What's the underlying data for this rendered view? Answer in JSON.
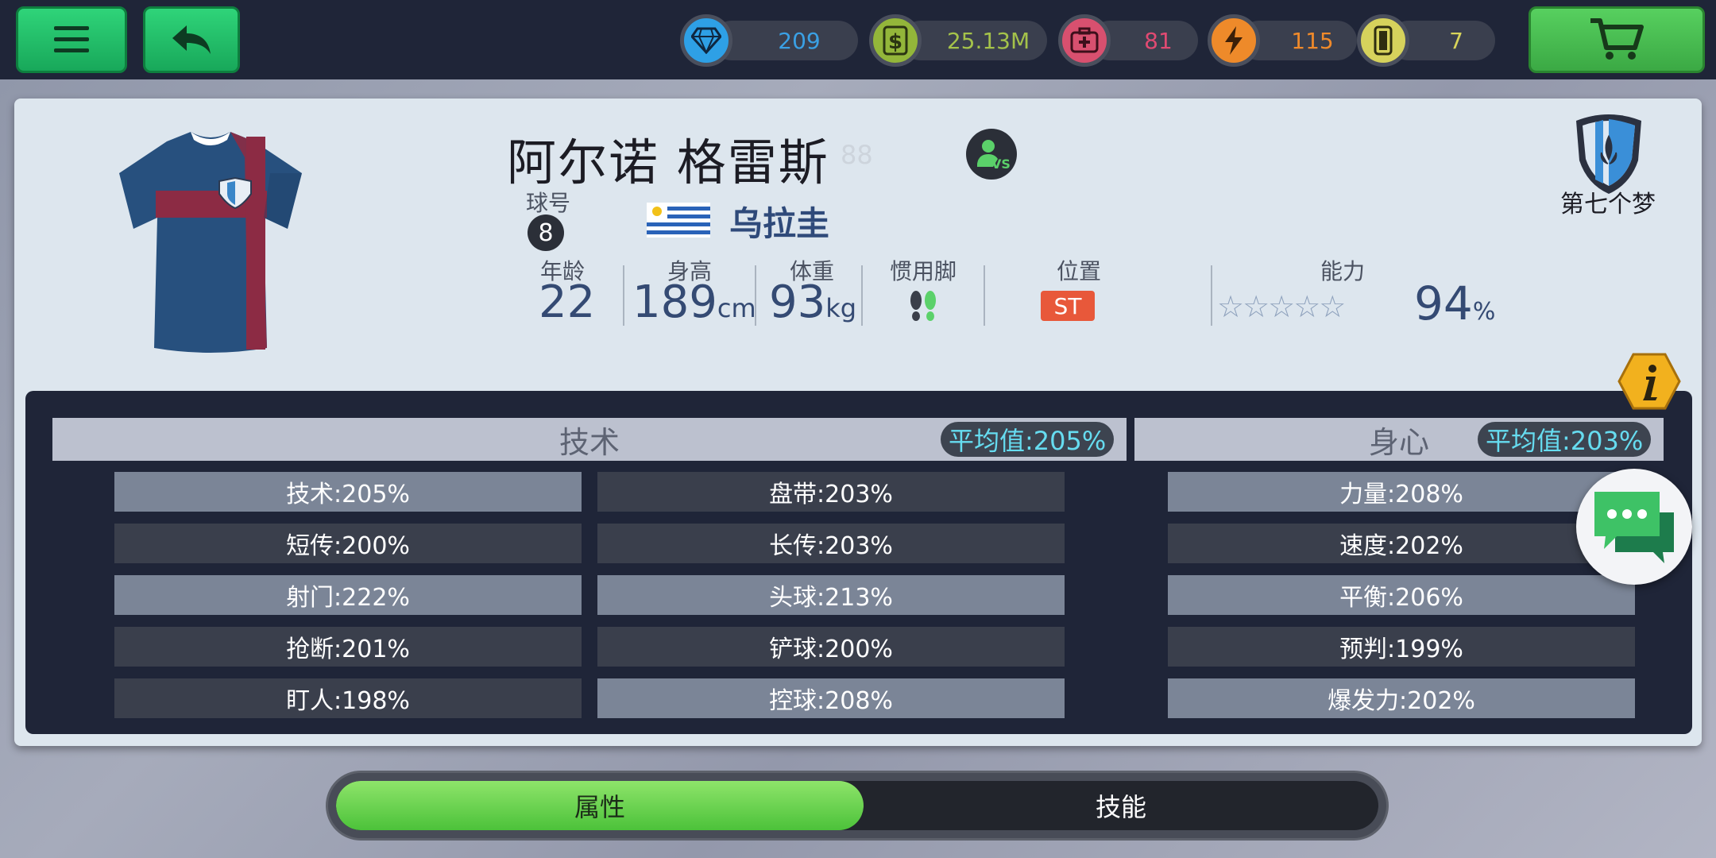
{
  "top_bar": {
    "menu_icon": "hamburger-menu-icon",
    "back_icon": "back-arrow-icon",
    "cart_icon": "shopping-cart-icon",
    "resources": [
      {
        "name": "diamond",
        "icon": "diamond-icon",
        "value": "209",
        "color": "#3aa0e4"
      },
      {
        "name": "cash",
        "icon": "dollar-icon",
        "value": "25.13M",
        "color": "#a4c24a"
      },
      {
        "name": "medical",
        "icon": "medkit-icon",
        "value": "81",
        "color": "#e04a72"
      },
      {
        "name": "energy",
        "icon": "lightning-icon",
        "value": "115",
        "color": "#f08a2a"
      },
      {
        "name": "cards",
        "icon": "card-icon",
        "value": "7",
        "color": "#d8d45a"
      }
    ]
  },
  "player": {
    "name": "阿尔诺 格雷斯",
    "faded_number": "88",
    "jersey_label": "球号",
    "jersey_number": "8",
    "country": "乌拉圭",
    "age_label": "年龄",
    "age": "22",
    "height_label": "身高",
    "height": "189",
    "height_unit": "cm",
    "weight_label": "体重",
    "weight": "93",
    "weight_unit": "kg",
    "foot_label": "惯用脚",
    "position_label": "位置",
    "position": "ST",
    "ability_label": "能力",
    "stars": "☆☆☆☆☆",
    "ability": "94",
    "ability_unit": "%",
    "club_name": "第七个梦"
  },
  "technique": {
    "title": "技术",
    "average": "平均值:205%",
    "col1": [
      {
        "text": "技术:205%",
        "style": "hl"
      },
      {
        "text": "短传:200%",
        "style": "dk"
      },
      {
        "text": "射门:222%",
        "style": "hl"
      },
      {
        "text": "抢断:201%",
        "style": "dk"
      },
      {
        "text": "盯人:198%",
        "style": "dk"
      }
    ],
    "col2": [
      {
        "text": "盘带:203%",
        "style": "dk"
      },
      {
        "text": "长传:203%",
        "style": "dk"
      },
      {
        "text": "头球:213%",
        "style": "hl"
      },
      {
        "text": "铲球:200%",
        "style": "dk"
      },
      {
        "text": "控球:208%",
        "style": "hl"
      }
    ]
  },
  "physical": {
    "title": "身心",
    "average": "平均值:203%",
    "col": [
      {
        "text": "力量:208%",
        "style": "hl"
      },
      {
        "text": "速度:202%",
        "style": "dk"
      },
      {
        "text": "平衡:206%",
        "style": "hl"
      },
      {
        "text": "预判:199%",
        "style": "dk"
      },
      {
        "text": "爆发力:202%",
        "style": "hl"
      }
    ]
  },
  "tabs": {
    "attributes": "属性",
    "skills": "技能"
  }
}
